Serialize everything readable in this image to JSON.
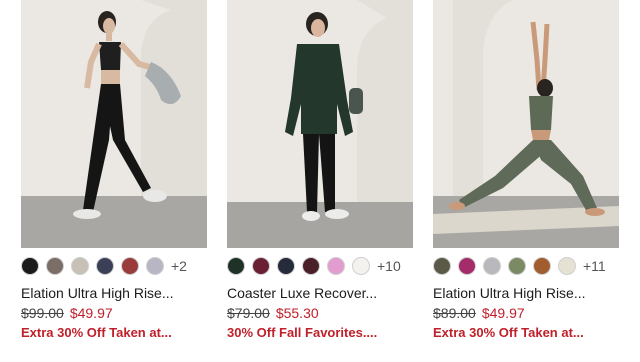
{
  "products": [
    {
      "name": "Elation Ultra High Rise...",
      "price_original": "$99.00",
      "price_sale": "$49.97",
      "promo": "Extra 30% Off Taken at...",
      "more_colors": "+2",
      "swatches": [
        "#1b1b1b",
        "#7a6e66",
        "#c9c0b5",
        "#3b3f57",
        "#9b3c3c",
        "#b8b6c4"
      ],
      "image_icon": "model-walking-photo"
    },
    {
      "name": "Coaster Luxe Recover...",
      "price_original": "$79.00",
      "price_sale": "$55.30",
      "promo": "30% Off Fall Favorites....",
      "more_colors": "+10",
      "swatches": [
        "#1f3228",
        "#6b1f33",
        "#252b3a",
        "#4a1f2a",
        "#e39ccf",
        "#f4f2ee"
      ],
      "image_icon": "model-standing-photo"
    },
    {
      "name": "Elation Ultra High Rise...",
      "price_original": "$89.00",
      "price_sale": "$49.97",
      "promo": "Extra 30% Off Taken at...",
      "more_colors": "+11",
      "swatches": [
        "#5b5a47",
        "#a42c6a",
        "#b9b9bd",
        "#7a8a63",
        "#a15d2e",
        "#e6e2d3"
      ],
      "image_icon": "model-yoga-pose-photo"
    }
  ]
}
